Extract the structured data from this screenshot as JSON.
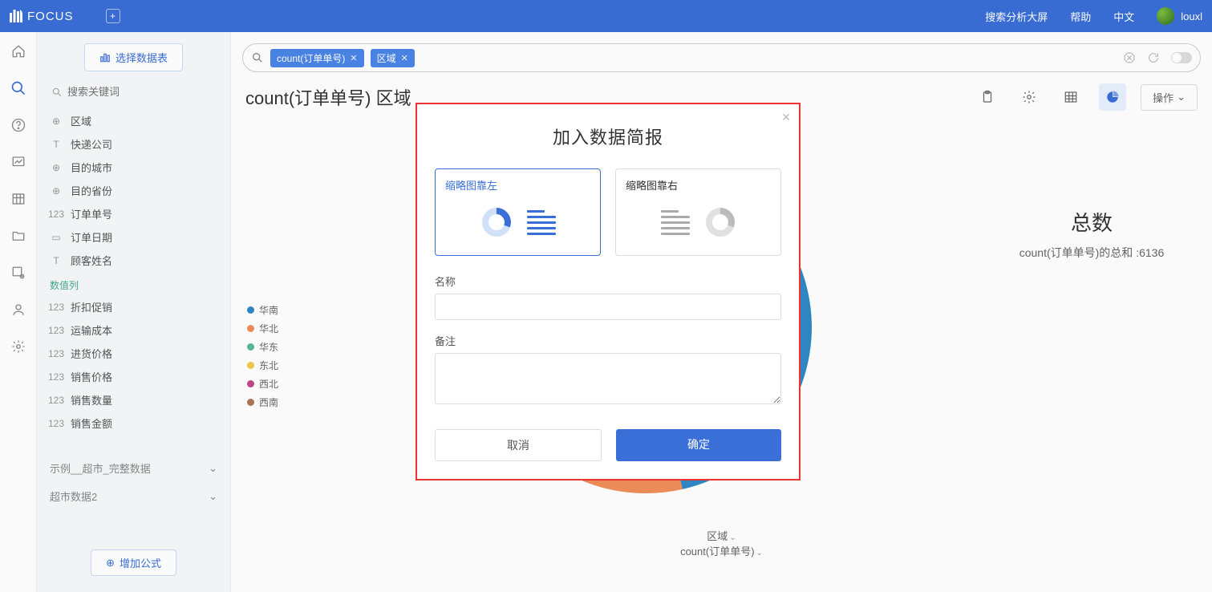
{
  "topbar": {
    "brand": "FOCUS",
    "links": {
      "dashboard": "搜索分析大屏",
      "help": "帮助",
      "lang": "中文"
    },
    "username": "louxl"
  },
  "side": {
    "select_table": "选择数据表",
    "search_placeholder": "搜索关键词",
    "attrs": [
      {
        "icon": "globe",
        "label": "区域"
      },
      {
        "icon": "text",
        "label": "快递公司"
      },
      {
        "icon": "globe",
        "label": "目的城市"
      },
      {
        "icon": "globe",
        "label": "目的省份"
      },
      {
        "icon": "num",
        "label": "订单单号"
      },
      {
        "icon": "date",
        "label": "订单日期"
      },
      {
        "icon": "text",
        "label": "顾客姓名"
      }
    ],
    "num_header": "数值列",
    "nums": [
      {
        "label": "折扣促销"
      },
      {
        "label": "运输成本"
      },
      {
        "label": "进货价格"
      },
      {
        "label": "销售价格"
      },
      {
        "label": "销售数量"
      },
      {
        "label": "销售金额"
      }
    ],
    "datasources": [
      {
        "label": "示例__超市_完整数据"
      },
      {
        "label": "超市数据2"
      }
    ],
    "add_formula": "增加公式"
  },
  "query": {
    "chips": [
      {
        "text": "count(订单单号)"
      },
      {
        "text": "区域"
      }
    ]
  },
  "page": {
    "title": "count(订单单号) 区域",
    "ops": "操作"
  },
  "chart_data": {
    "type": "pie",
    "title": "count(订单单号) 区域",
    "series_name": "区域",
    "categories": [
      "华南",
      "华北",
      "华东",
      "东北",
      "西北",
      "西南"
    ],
    "colors": [
      "#2f88c5",
      "#ef8e5a",
      "#59b99a",
      "#f1c94e",
      "#c24a8a",
      "#b3755a"
    ],
    "total_label": "总数",
    "total_field_label": "count(订单单号)的总和",
    "total_value": 6136,
    "values_estimated": [
      2850,
      1700,
      350,
      980,
      130,
      126
    ],
    "axis_labels": {
      "category": "区域",
      "measure": "count(订单单号)"
    }
  },
  "modal": {
    "title": "加入数据简报",
    "layout_left": "缩略图靠左",
    "layout_right": "缩略图靠右",
    "name_label": "名称",
    "note_label": "备注",
    "cancel": "取消",
    "ok": "确定"
  }
}
